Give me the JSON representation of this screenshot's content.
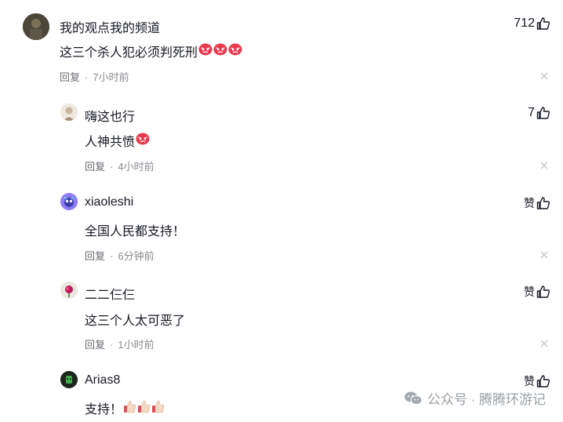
{
  "comments": [
    {
      "username": "我的观点我的频道",
      "text": "这三个杀人犯必须判死刑",
      "emoji_count": 3,
      "emoji": "angry-face",
      "reply_label": "回复",
      "time": "7小时前",
      "likes": "712"
    },
    {
      "username": "嗨这也行",
      "text": "人神共愤",
      "emoji_count": 1,
      "emoji": "angry-face",
      "reply_label": "回复",
      "time": "4小时前",
      "likes": "7"
    },
    {
      "username": "xiaoleshi",
      "text": "全国人民都支持！",
      "emoji_count": 0,
      "reply_label": "回复",
      "time": "6分钟前",
      "likes": "赞"
    },
    {
      "username": "二二仨仨",
      "text": "这三个人太可恶了",
      "emoji_count": 0,
      "reply_label": "回复",
      "time": "1小时前",
      "likes": "赞"
    },
    {
      "username": "Arias8",
      "text": "支持！",
      "emoji_count": 3,
      "emoji": "thumbs-up",
      "likes": "赞"
    }
  ],
  "watermark": "公众号 · 腾腾环游记",
  "colors": {
    "text": "#161823",
    "meta": "#8a8b91",
    "watermark": "#9aa0a6"
  }
}
